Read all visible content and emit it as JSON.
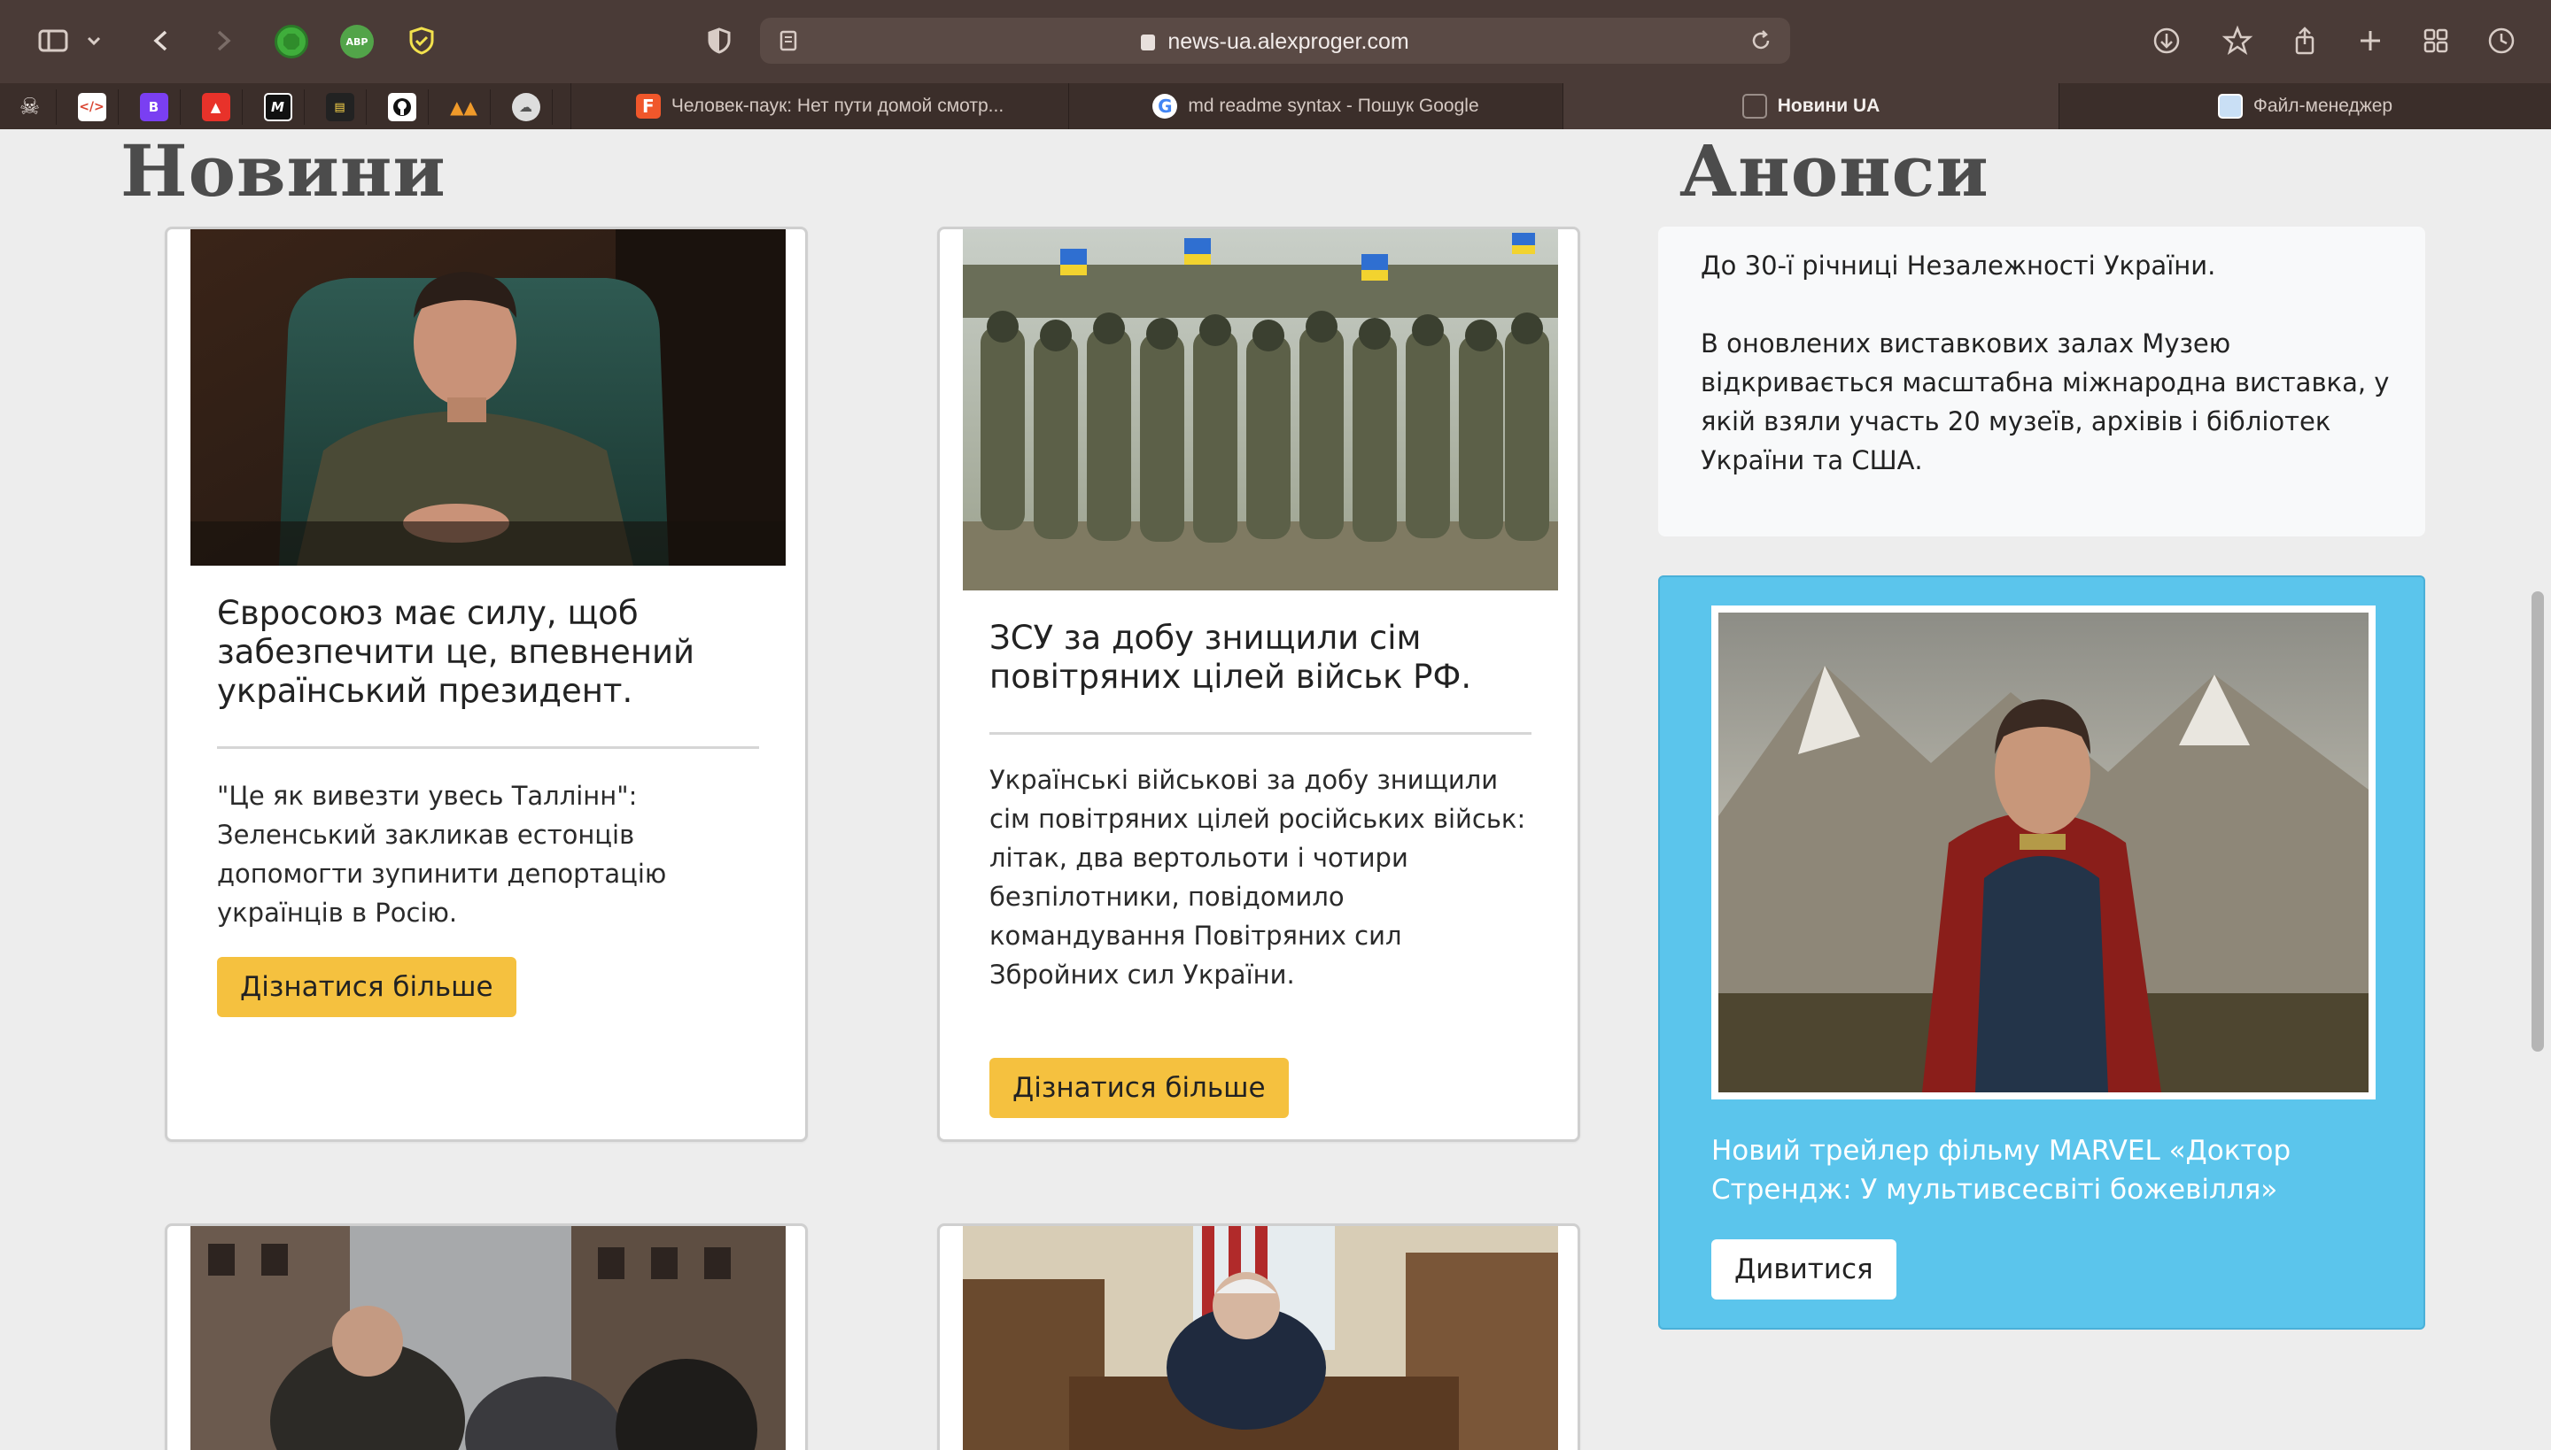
{
  "browser": {
    "url": "news-ua.alexproger.com",
    "extensions": [
      "adblock-ext",
      "ABP",
      "shield-ext"
    ]
  },
  "tabs": [
    {
      "title": "Человек-паук: Нет пути домой смотр...",
      "active": false
    },
    {
      "title": "md readme syntax - Пошук Google",
      "active": false
    },
    {
      "title": "Новини UA",
      "active": true
    },
    {
      "title": "Файл-менеджер",
      "active": false
    }
  ],
  "news": {
    "heading": "Новини",
    "cards": [
      {
        "title": "Євросоюз має силу, щоб забезпечити це, впевнений український президент.",
        "text": "\"Це як вивезти увесь Таллінн\": Зеленський закликав естонців допомогти зупинити депортацію українців в Росію.",
        "button": "Дізнатися більше",
        "image": "president-photo"
      },
      {
        "title": "ЗСУ за добу знищили сім повітряних цілей військ РФ.",
        "text": "Українські військові за добу знищили сім повітряних цілей російських військ: літак, два вертольоти і чотири безпілотники, повідомило командування Повітряних сил Збройних сил України.",
        "button": "Дізнатися більше",
        "image": "soldiers-photo"
      },
      {
        "image": "ruins-photo"
      },
      {
        "image": "office-photo"
      }
    ]
  },
  "announcements": {
    "heading": "Анонси",
    "box": {
      "line1": "До 30-ї річниці Незалежності України.",
      "line2": "В оновлених виставкових залах Музею відкривається масштабна міжнародна виставка, у якій взяли участь 20 музеїв, архівів і бібліотек України та США."
    },
    "promo": {
      "title": "Новий трейлер фільму MARVEL «Доктор Стрендж: У мультивсесвіті божевілля»",
      "button": "Дивитися",
      "image": "movie-poster"
    }
  },
  "colors": {
    "toolbar": "#4a3b37",
    "accent_button": "#f5c13f",
    "promo_bg": "#5bc5ec"
  }
}
